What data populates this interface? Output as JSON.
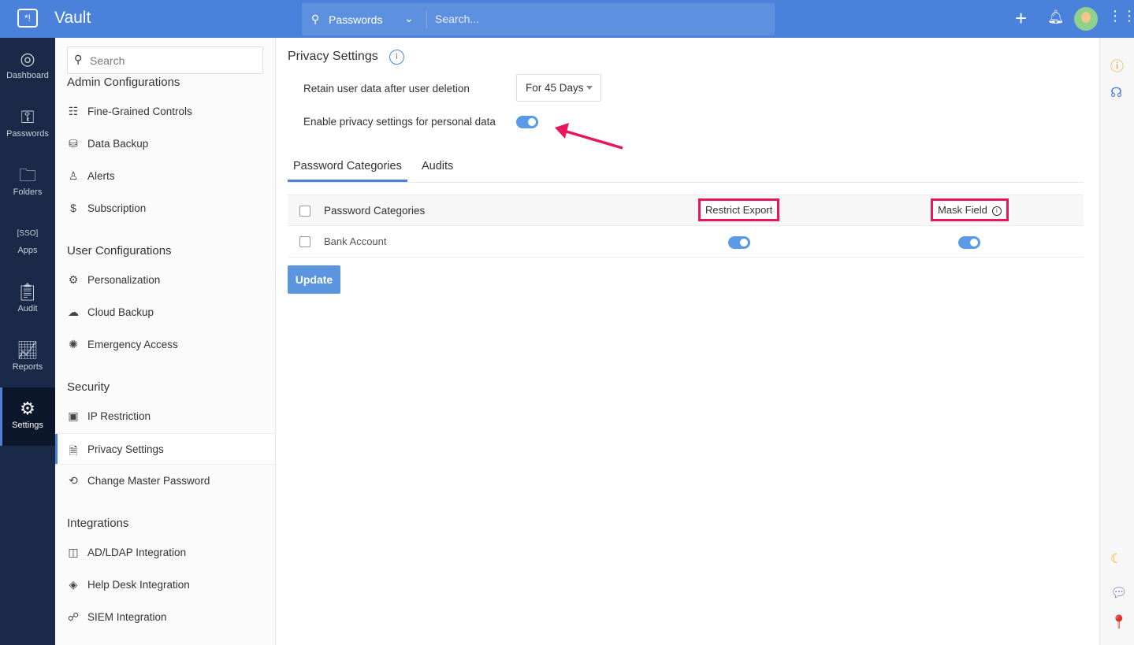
{
  "app": {
    "title": "Vault"
  },
  "topbar": {
    "search_category": "Passwords",
    "search_placeholder": "Search..."
  },
  "nav": [
    {
      "label": "Dashboard",
      "icon": "compass-icon"
    },
    {
      "label": "Passwords",
      "icon": "key-icon"
    },
    {
      "label": "Folders",
      "icon": "folder-icon"
    },
    {
      "label": "Apps",
      "icon": "sso-icon"
    },
    {
      "label": "Audit",
      "icon": "clipboard-icon"
    },
    {
      "label": "Reports",
      "icon": "chart-icon"
    },
    {
      "label": "Settings",
      "icon": "gear-icon"
    }
  ],
  "sidebar": {
    "search_placeholder": "Search",
    "groups": [
      {
        "title": "Admin Configurations",
        "items": [
          "Fine-Grained Controls",
          "Data Backup",
          "Alerts",
          "Subscription"
        ]
      },
      {
        "title": "User Configurations",
        "items": [
          "Personalization",
          "Cloud Backup",
          "Emergency Access"
        ]
      },
      {
        "title": "Security",
        "items": [
          "IP Restriction",
          "Privacy Settings",
          "Change Master Password"
        ]
      },
      {
        "title": "Integrations",
        "items": [
          "AD/LDAP Integration",
          "Help Desk Integration",
          "SIEM Integration"
        ]
      }
    ]
  },
  "main": {
    "title": "Privacy Settings",
    "retain_label": "Retain user data after user deletion",
    "retain_value": "For 45 Days",
    "enable_label": "Enable privacy settings for personal data",
    "enable_on": true,
    "tabs": [
      "Password Categories",
      "Audits"
    ],
    "table": {
      "headers": [
        "Password Categories",
        "Restrict Export",
        "Mask Field"
      ],
      "rows": [
        {
          "name": "Bank Account",
          "restrict_export": true,
          "mask_field": true
        }
      ]
    },
    "update_label": "Update"
  },
  "colors": {
    "accent": "#4a81da",
    "highlight": "#e8175d"
  }
}
